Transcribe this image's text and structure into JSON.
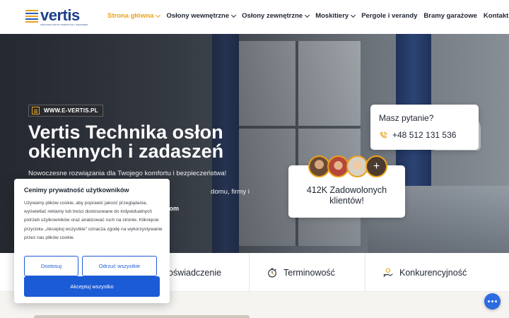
{
  "header": {
    "logo_text": "vertis",
    "logo_tagline": "TECHNIKA OSŁON OKIENNYCH I ZADASZEŃ",
    "nav": [
      {
        "label": "Strona główna",
        "dropdown": true,
        "active": true
      },
      {
        "label": "Osłony wewnętrzne",
        "dropdown": true,
        "active": false
      },
      {
        "label": "Osłony zewnętrzne",
        "dropdown": true,
        "active": false
      },
      {
        "label": "Moskitiery",
        "dropdown": true,
        "active": false
      },
      {
        "label": "Pergole i verandy",
        "dropdown": false,
        "active": false
      },
      {
        "label": "Bramy garażowe",
        "dropdown": false,
        "active": false
      },
      {
        "label": "Kontakt",
        "dropdown": false,
        "active": false
      }
    ]
  },
  "hero": {
    "site_badge": "WWW.E-VERTIS.PL",
    "title": "Vertis Technika osłon okiennych i zadaszeń",
    "description": "Nowoczesne rozwiązania dla Twojego komfortu i bezpieczeństwa! Profesjonalne",
    "description_2": "domu, firmy i przemysłu.",
    "email_fragment": "ail.com",
    "ask": {
      "title": "Masz pytanie?",
      "phone": "+48 512 131 536"
    },
    "clients": {
      "text": "412K Zadowolonych klientów!",
      "more_symbol": "+"
    }
  },
  "features": [
    {
      "label": "Doświadczenie",
      "icon": "handshake-icon"
    },
    {
      "label": "Terminowość",
      "icon": "stopwatch-icon"
    },
    {
      "label": "Konkurencyjność",
      "icon": "money-hand-icon"
    }
  ],
  "cookie": {
    "title": "Cenimy prywatność użytkowników",
    "text": "Używamy plików cookie, aby poprawić jakość przeglądania, wyświetlać reklamy lub treści dostosowane do indywidualnych potrzeb użytkowników oraz analizować ruch na stronie. Kliknięcie przycisku „Akceptuj wszystkie” oznacza zgodę na wykorzystywanie przez nas plików cookie.",
    "customize_label": "Dostosuj",
    "reject_label": "Odrzuć wszystkie",
    "accept_label": "Akceptuj wszystko"
  },
  "colors": {
    "accent": "#e9a21e",
    "brand": "#1c3f8a",
    "button": "#1c5bd6"
  }
}
